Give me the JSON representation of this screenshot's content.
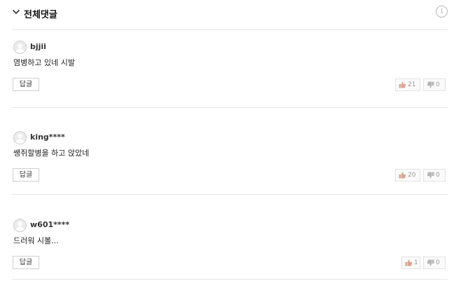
{
  "section": {
    "title": "전체댓글"
  },
  "comments": [
    {
      "nickname": "bjjii",
      "text": "염병하고 있네 시발",
      "reply_label": "답글",
      "likes": "21",
      "dislikes": "0"
    },
    {
      "nickname": "king****",
      "text": "쌩쥐할병을 하고 앉았네",
      "reply_label": "답글",
      "likes": "20",
      "dislikes": "0"
    },
    {
      "nickname": "w601****",
      "text": "드러워 시볼...",
      "reply_label": "답글",
      "likes": "1",
      "dislikes": "0"
    }
  ],
  "icons": {
    "collapse": "chevron-down-icon",
    "info": "info-icon",
    "like": "thumbs-up-icon",
    "dislike": "thumbs-down-icon",
    "avatar": "default-avatar-icon"
  },
  "colors": {
    "like_icon": "#d9a595",
    "dislike_icon": "#b5b5b5",
    "divider": "#e6e6e6"
  }
}
